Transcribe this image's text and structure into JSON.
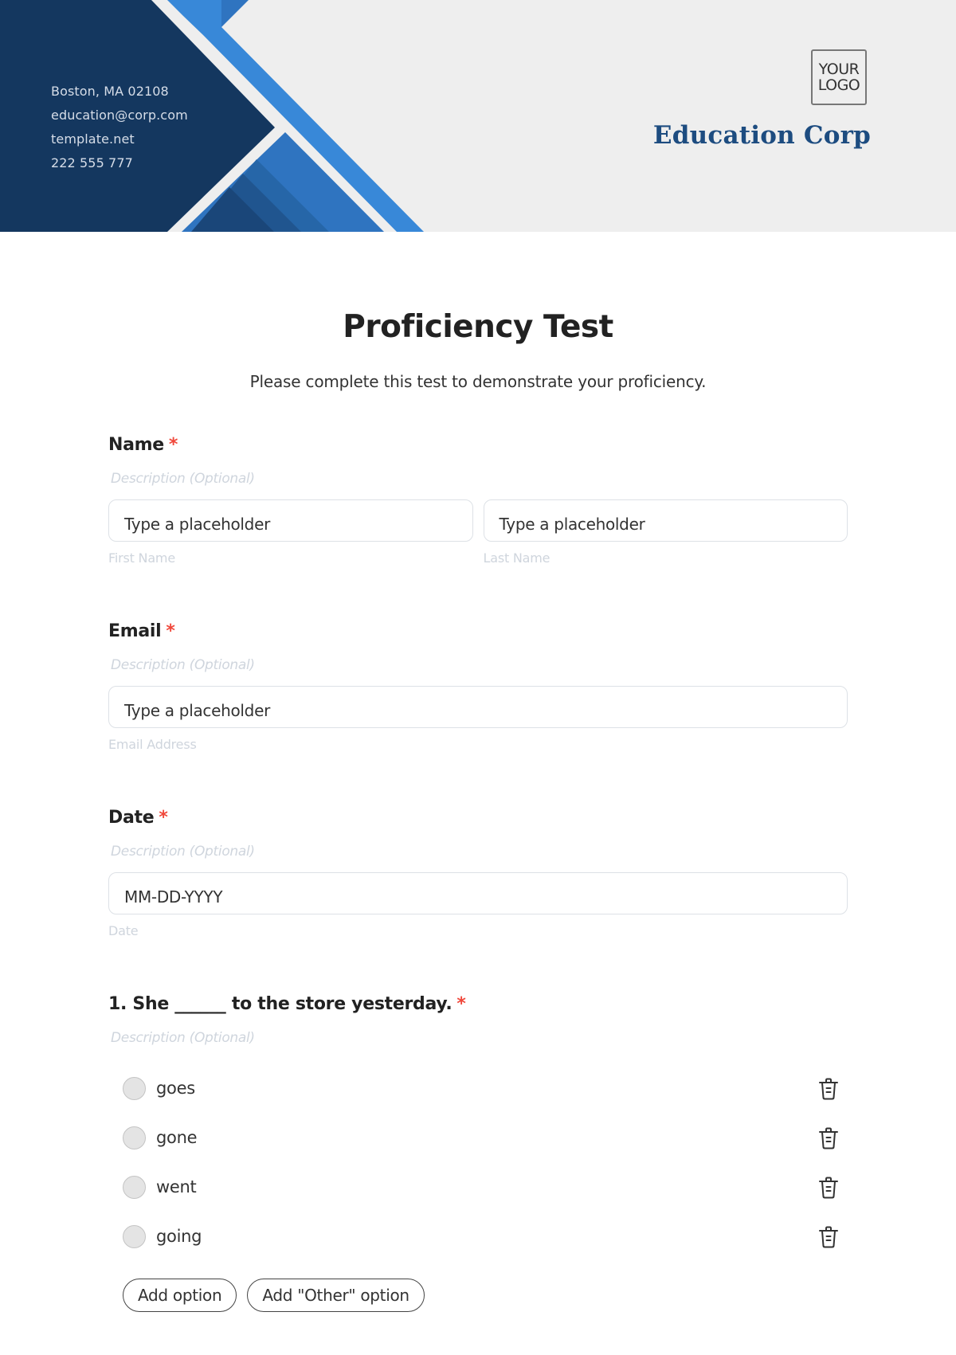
{
  "header": {
    "contact": [
      "Boston, MA 02108",
      "education@corp.com",
      "template.net",
      "222 555 777"
    ],
    "logo_lines": [
      "YOUR",
      "LOGO"
    ],
    "company_name": "Education Corp",
    "colors": {
      "navy": "#14375f",
      "blue": "#3888d8",
      "mid_blue": "#2f74c0",
      "background": "#eeeeee",
      "brand_text": "#1d4c80"
    }
  },
  "form": {
    "title": "Proficiency Test",
    "subtitle": "Please complete this test to demonstrate your proficiency.",
    "required_marker": "*",
    "fields": {
      "name": {
        "label": "Name",
        "description": "Description (Optional)",
        "inputs": [
          {
            "value": "Type a placeholder",
            "sub_label": "First Name"
          },
          {
            "value": "Type a placeholder",
            "sub_label": "Last Name"
          }
        ]
      },
      "email": {
        "label": "Email",
        "description": "Description (Optional)",
        "value": "Type a placeholder",
        "sub_label": "Email Address"
      },
      "date": {
        "label": "Date",
        "description": "Description (Optional)",
        "value": "MM-DD-YYYY",
        "sub_label": "Date"
      }
    },
    "question1": {
      "label": "1. She ______ to the store yesterday.",
      "description": "Description (Optional)",
      "options": [
        "goes",
        "gone",
        "went",
        "going"
      ],
      "icons": {
        "delete": "trash-icon"
      },
      "add_option_label": "Add option",
      "add_other_label": "Add \"Other\" option"
    }
  }
}
